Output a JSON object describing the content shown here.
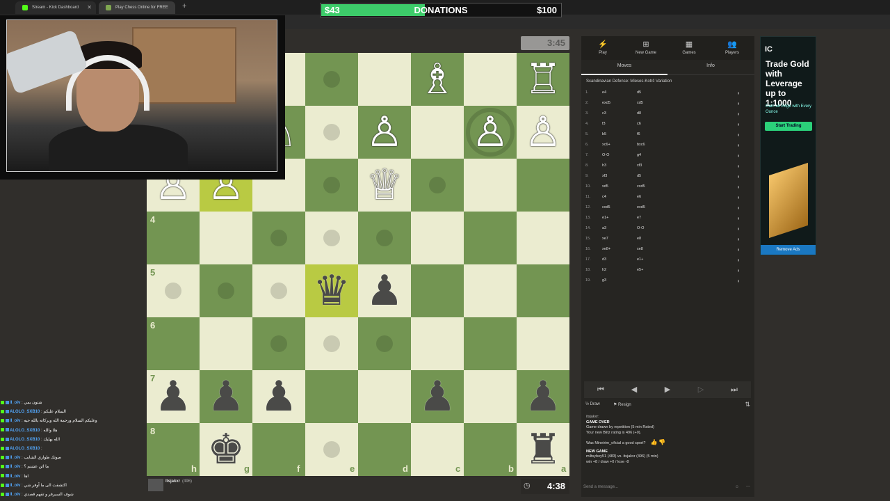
{
  "browser": {
    "tabs": [
      {
        "label": "Stream - Kick Dashboard"
      },
      {
        "label": "Play Chess Online for FREE"
      }
    ]
  },
  "donations": {
    "raised": "$43",
    "label": "DONATIONS",
    "goal": "$100",
    "progress": 0.43,
    "color": "#3dcc6a"
  },
  "board": {
    "ranks": [
      "4",
      "5",
      "6",
      "7",
      "8"
    ],
    "files": [
      "h",
      "g",
      "f",
      "e",
      "d",
      "c",
      "b",
      "a"
    ]
  },
  "clocks": {
    "top": "3:45",
    "bottom": "4:38"
  },
  "chat": [
    {
      "user": "II_oiv",
      "msg": "شتون يمي"
    },
    {
      "user": "ALOLO_SXB10",
      "msg": "السلام عليكم"
    },
    {
      "user": "II_oiv",
      "msg": "وعليكم السلام ورحمة الله وبركاته يالله حيه"
    },
    {
      "user": "ALOLO_SXB10",
      "msg": "هلا والله"
    },
    {
      "user": "ALOLO_SXB10",
      "msg": "الله يهليك"
    },
    {
      "user": "ALOLO_SXB10",
      "msg": ""
    },
    {
      "user": "II_oiv",
      "msg": "صوتك طواري الشايب"
    },
    {
      "user": "II_oiv",
      "msg": "ما اثن عشنم ؟"
    },
    {
      "user": "II_oiv",
      "msg": "اها"
    },
    {
      "user": "II_oiv",
      "msg": "اكتشفت الى ما آوفر شي"
    },
    {
      "user": "II_oiv",
      "msg": "شوف السيرفر و تقهم قصدي"
    }
  ],
  "player_bottom": {
    "name": "Itsjakxr",
    "rating": "(496)"
  },
  "panel": {
    "nav": [
      {
        "label": "Play"
      },
      {
        "label": "New Game"
      },
      {
        "label": "Games"
      },
      {
        "label": "Players"
      }
    ],
    "subtabs": [
      "Moves",
      "Info"
    ],
    "opening": "Scandinavian Defense: Mieses-Kotrč Variation",
    "moves": [
      {
        "n": "1.",
        "w": "e4",
        "b": "d5"
      },
      {
        "n": "2.",
        "w": "exd5",
        "b": "xd5"
      },
      {
        "n": "3.",
        "w": "c3",
        "b": "d8"
      },
      {
        "n": "4.",
        "w": "f3",
        "b": "c6"
      },
      {
        "n": "5.",
        "w": "b5",
        "b": "f6"
      },
      {
        "n": "6.",
        "w": "xc6+",
        "b": "bxc6"
      },
      {
        "n": "7.",
        "w": "O-O",
        "b": "g4"
      },
      {
        "n": "8.",
        "w": "h3",
        "b": "xf3"
      },
      {
        "n": "9.",
        "w": "xf3",
        "b": "d5"
      },
      {
        "n": "10.",
        "w": "xd5",
        "b": "cxd5"
      },
      {
        "n": "11.",
        "w": "c4",
        "b": "e6"
      },
      {
        "n": "12.",
        "w": "cxd5",
        "b": "exd5"
      },
      {
        "n": "13.",
        "w": "e1+",
        "b": "e7"
      },
      {
        "n": "14.",
        "w": "a3",
        "b": "O-O"
      },
      {
        "n": "15.",
        "w": "xe7",
        "b": "e8"
      },
      {
        "n": "16.",
        "w": "xe8+",
        "b": "xe8"
      },
      {
        "n": "17.",
        "w": "d3",
        "b": "e1+"
      },
      {
        "n": "18.",
        "w": "h2",
        "b": "e5+"
      },
      {
        "n": "19.",
        "w": "g3",
        "b": ""
      }
    ],
    "actions": {
      "draw": "Draw",
      "resign": "Resign"
    },
    "game": {
      "user": "itsjakxr:",
      "over": "GAME OVER",
      "line1": "Game drawn by repetition (5 min Rated)",
      "line2": "Your new Blitz rating is 496 (+0).",
      "question": "Was Mineirim_oficial a good sport?",
      "newgame": "NEW GAME",
      "vs": "miltsyboy51 (483) vs. itsjakxr (496) (5 min)",
      "record": "win +8 / draw +0 / lose -8"
    },
    "send_placeholder": "Send a message..."
  },
  "ad": {
    "logo": "IC",
    "headline": "Trade Gold with Leverage up to 1:1000",
    "sub": "Gain an Edge with Every Ounce",
    "cta": "Start Trading",
    "remove": "Remove Ads"
  }
}
